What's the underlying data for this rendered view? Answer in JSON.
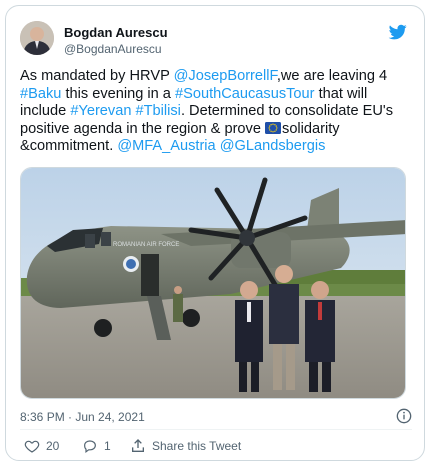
{
  "author": {
    "name": "Bogdan Aurescu",
    "handle": "@BogdanAurescu"
  },
  "tweet": {
    "text_segments": [
      {
        "t": "As mandated by HRVP ",
        "link": false
      },
      {
        "t": "@JosepBorrellF",
        "link": true
      },
      {
        "t": ",we are leaving 4 ",
        "link": false
      },
      {
        "t": "#Baku",
        "link": true
      },
      {
        "t": " this evening in a ",
        "link": false
      },
      {
        "t": "#SouthCaucasusTour",
        "link": true
      },
      {
        "t": " that will include ",
        "link": false
      },
      {
        "t": "#Yerevan",
        "link": true
      },
      {
        "t": " ",
        "link": false
      },
      {
        "t": "#Tbilisi",
        "link": true
      },
      {
        "t": ". Determined to consolidate EU's positive agenda in the region & prove ",
        "link": false
      },
      {
        "t": "[EU-FLAG]",
        "link": false
      },
      {
        "t": "solidarity &commitment. ",
        "link": false
      },
      {
        "t": "@MFA_Austria",
        "link": true
      },
      {
        "t": " ",
        "link": false
      },
      {
        "t": "@GLandsbergis",
        "link": true
      }
    ],
    "photo_text": "ROMANIAN AIR FORCE",
    "timestamp": "8:36 PM · Jun 24, 2021"
  },
  "actions": {
    "likes": "20",
    "replies": "1",
    "share": "Share this Tweet"
  },
  "colors": {
    "link": "#1d9bf0",
    "muted": "#536471",
    "like": "#f91880"
  },
  "icons": [
    "twitter-bird-icon",
    "info-icon",
    "heart-icon",
    "reply-icon",
    "share-icon",
    "eu-flag-emoji"
  ]
}
